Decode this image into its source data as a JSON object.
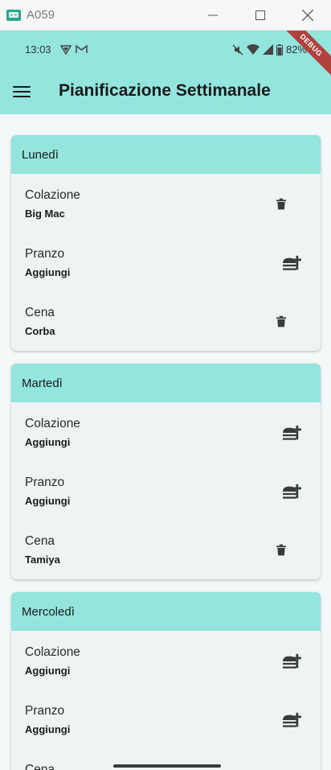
{
  "window": {
    "title": "A059"
  },
  "status_bar": {
    "time": "13:03",
    "battery": "82%"
  },
  "debug_banner": "DEBUG",
  "app_bar": {
    "title": "Pianificazione Settimanale"
  },
  "days": [
    {
      "name": "Lunedì",
      "meals": [
        {
          "label": "Colazione",
          "value": "Big Mac",
          "action": "trash-icon"
        },
        {
          "label": "Pranzo",
          "value": "Aggiungi",
          "action": "add-meal-icon"
        },
        {
          "label": "Cena",
          "value": "Corba",
          "action": "trash-icon"
        }
      ]
    },
    {
      "name": "Martedì",
      "meals": [
        {
          "label": "Colazione",
          "value": "Aggiungi",
          "action": "add-meal-icon"
        },
        {
          "label": "Pranzo",
          "value": "Aggiungi",
          "action": "add-meal-icon"
        },
        {
          "label": "Cena",
          "value": "Tamiya",
          "action": "trash-icon"
        }
      ]
    },
    {
      "name": "Mercoledì",
      "meals": [
        {
          "label": "Colazione",
          "value": "Aggiungi",
          "action": "add-meal-icon"
        },
        {
          "label": "Pranzo",
          "value": "Aggiungi",
          "action": "add-meal-icon"
        },
        {
          "label": "Cena",
          "value": "",
          "action": "add-meal-icon"
        }
      ]
    }
  ],
  "colors": {
    "accent": "#93e5de",
    "card_bg": "#eef3f3",
    "page_bg": "#f3f8f8",
    "debug_ribbon": "#b0413e"
  }
}
